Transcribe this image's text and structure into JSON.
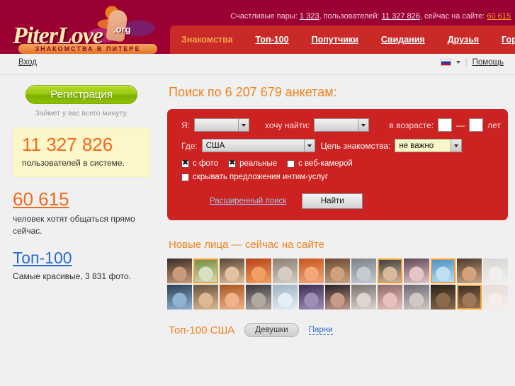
{
  "header": {
    "logo": {
      "word": "PiterLove",
      "org": ".org",
      "tagline": "ЗНАКОМСТВА В ПИТЕРЕ"
    },
    "stats": {
      "couples_label": "Счастливые пары:",
      "couples_value": "1 323",
      "users_label": ", пользователей:",
      "users_value": "11 327 826",
      "online_label": ", сейчас на сайте:",
      "online_value": "60 615"
    },
    "nav": [
      {
        "label": "Знакомства",
        "current": true
      },
      {
        "label": "Топ-100",
        "current": false
      },
      {
        "label": "Попутчики",
        "current": false
      },
      {
        "label": "Свидания",
        "current": false
      },
      {
        "label": "Друзья",
        "current": false
      },
      {
        "label": "Гороскопы",
        "current": false
      }
    ]
  },
  "subbar": {
    "login": "Вход",
    "language": "ru",
    "separator": "|",
    "help": "Помощь"
  },
  "sidebar": {
    "register_button": "Регистрация",
    "register_note": "Займет у вас всего минуту.",
    "users_count": "11 327 826",
    "users_label": "пользователей в системе.",
    "online_count": "60 615",
    "online_label": "человек хотят общаться прямо сейчас.",
    "top100_link": "Топ-100",
    "top100_note": "Самые красивые, 3 831 фото."
  },
  "search": {
    "title": "Поиск по 6 207 679 анкетам:",
    "me_label": "Я:",
    "me_value": "",
    "find_label": "хочу найти:",
    "find_value": "",
    "age_label": "в возрасте:",
    "age_from": "",
    "age_to": "",
    "age_dash": "—",
    "age_units": "лет",
    "where_label": "Где:",
    "where_value": "США",
    "goal_label": "Цель знакомства:",
    "goal_value": "не важно",
    "checkboxes": [
      {
        "label": "с фото",
        "checked": true
      },
      {
        "label": "реальные",
        "checked": true
      },
      {
        "label": "с веб-камерой",
        "checked": false
      },
      {
        "label": "скрывать предложения интим-услуг",
        "checked": false
      }
    ],
    "advanced_link": "Расширенный поиск",
    "submit_button": "Найти"
  },
  "faces": {
    "title": "Новые лица — сейчас на сайте",
    "items": [
      {
        "c1": "#3b2d26",
        "c2": "#c99a7a",
        "online": false
      },
      {
        "c1": "#6f8a3c",
        "c2": "#d8e0c0",
        "online": true
      },
      {
        "c1": "#5a4636",
        "c2": "#e3c2a0",
        "online": false
      },
      {
        "c1": "#b8421a",
        "c2": "#f0a060",
        "online": false
      },
      {
        "c1": "#8c7f72",
        "c2": "#d6cdc2",
        "online": false
      },
      {
        "c1": "#c7561e",
        "c2": "#f2a878",
        "online": false
      },
      {
        "c1": "#6b4a33",
        "c2": "#cfa27d",
        "online": false
      },
      {
        "c1": "#7b8288",
        "c2": "#c4cbd1",
        "online": false
      },
      {
        "c1": "#3a3a3c",
        "c2": "#d9b99c",
        "online": true
      },
      {
        "c1": "#5e4a58",
        "c2": "#e6c5c8",
        "online": false
      },
      {
        "c1": "#4a8ec4",
        "c2": "#bfe0f2",
        "online": true
      },
      {
        "c1": "#4d3b2e",
        "c2": "#d2a47e",
        "online": false
      },
      {
        "c1": "#d8d6d2",
        "c2": "#f2f0ee",
        "online": false
      },
      {
        "c1": "#2e3f55",
        "c2": "#8fb4d2",
        "online": false
      },
      {
        "c1": "#6a5340",
        "c2": "#dcb894",
        "online": false
      },
      {
        "c1": "#a8561f",
        "c2": "#f0b28a",
        "online": false
      },
      {
        "c1": "#3c3a40",
        "c2": "#b2a8a0",
        "online": false
      },
      {
        "c1": "#9db3c4",
        "c2": "#e4eef4",
        "online": false
      },
      {
        "c1": "#3e2f52",
        "c2": "#9e8fb8",
        "online": false
      },
      {
        "c1": "#2a2126",
        "c2": "#c79a8a",
        "online": false
      },
      {
        "c1": "#7a746e",
        "c2": "#ddd6d0",
        "online": false
      },
      {
        "c1": "#8f6a68",
        "c2": "#e8c0bc",
        "online": false
      },
      {
        "c1": "#6e6a74",
        "c2": "#cfc8c4",
        "online": false
      },
      {
        "c1": "#2b2018",
        "c2": "#8a6a4a",
        "online": false
      },
      {
        "c1": "#3a2c22",
        "c2": "#a07858",
        "online": true
      },
      {
        "c1": "#e8dcd6",
        "c2": "#f6eeea",
        "online": false
      }
    ]
  },
  "top100": {
    "title": "Топ-100 США",
    "tab_girls": "Девушки",
    "tab_guys": "Парни"
  },
  "colors": {
    "header_bg": "#9b0033",
    "nav_bg": "#c92a28",
    "panel_red": "#cc2222",
    "accent_orange": "#f0821e",
    "link_blue": "#2a6bd6",
    "green_button": "#9ccc10",
    "yellow_box": "#fdf6c8"
  }
}
